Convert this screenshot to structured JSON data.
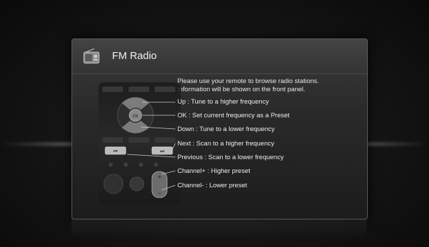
{
  "panel": {
    "title": "FM Radio",
    "icon": "radio-icon",
    "instructions": [
      "Please use your remote to browse radio stations.",
      "Information will be shown on the front panel."
    ],
    "legend": [
      {
        "key": "up",
        "label": "Up : Tune to a higher frequency"
      },
      {
        "key": "ok",
        "label": "OK : Set current frequency as a Preset"
      },
      {
        "key": "down",
        "label": "Down : Tune to a lower frequency"
      },
      {
        "key": "next",
        "label": "Next : Scan to a higher frequency"
      },
      {
        "key": "previous",
        "label": "Previous : Scan to a lower frequency"
      },
      {
        "key": "channel-plus",
        "label": "Channel+ : Higher preset"
      },
      {
        "key": "channel-minus",
        "label": "Channel- : Lower preset"
      }
    ]
  },
  "remote": {
    "buttons": {
      "ok": "OK",
      "prev": "⏮",
      "next": "⏭",
      "ch_up": "+",
      "ch_down": "−"
    }
  },
  "colors": {
    "accent": "#e8e8e8",
    "panel_bg": "#2c2c2c"
  }
}
